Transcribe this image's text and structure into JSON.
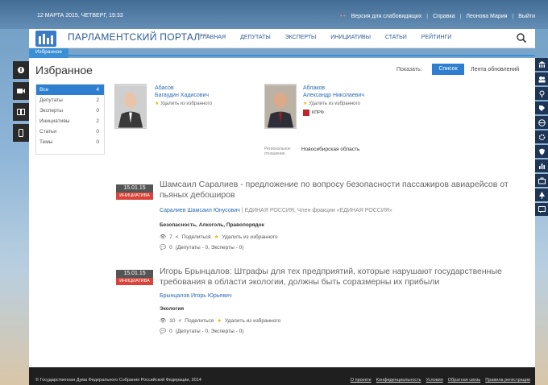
{
  "topbar": {
    "date": "12 МАРТА 2015, ЧЕТВЕРГ, 19:33",
    "accessible": "Версия для слабовидящих",
    "help": "Справка",
    "user": "Леонова Мария",
    "logout": "Выйти"
  },
  "header": {
    "title": "ПАРЛАМЕНТСКИЙ ПОРТАЛ",
    "beta": "beta",
    "nav": [
      "ГЛАВНАЯ",
      "ДЕПУТАТЫ",
      "ЭКСПЕРТЫ",
      "ИНИЦИАТИВЫ",
      "СТАТЬИ",
      "РЕЙТИНГИ"
    ]
  },
  "tabstrip": {
    "active": "Избранное"
  },
  "main": {
    "title": "Избранное",
    "show_label": "Показать:",
    "list_btn": "Список",
    "feed_btn": "Лента обновлений",
    "categories": [
      {
        "label": "Все",
        "count": "4"
      },
      {
        "label": "Депутаты",
        "count": "2"
      },
      {
        "label": "Эксперты",
        "count": "0"
      },
      {
        "label": "Инициативы",
        "count": "2"
      },
      {
        "label": "Статьи",
        "count": "0"
      },
      {
        "label": "Темы",
        "count": "0"
      }
    ],
    "deputies": [
      {
        "surname": "Абасов",
        "name": "Багаудин Хадисович",
        "remove": "Удалить из избранного"
      },
      {
        "surname": "Аблаков",
        "name": "Александр Николаевич",
        "remove": "Удалить из избранного",
        "party": "КПРФ",
        "region_label_1": "Региональное",
        "region_label_2": "отношение",
        "region": "Новосибирская область"
      }
    ],
    "items": [
      {
        "date": "15.01.15",
        "type": "ИНИЦИАТИВА",
        "title_1": "Шамсаил Саралиев - предложение по вопросу безопасности пассажиров авиарейсов от",
        "title_2": "пьяных дебоширов",
        "author": "Саралиев Шамсаил Юнусович",
        "party": "| ЕДИНАЯ РОССИЯ, Член фракции «ЕДИНАЯ РОССИЯ»",
        "tags": "Безопасность,  Алкоголь,  Правопорядок",
        "views": "7",
        "share": "Поделиться",
        "remove": "Удалить из избранного",
        "comments_count": "0",
        "comments_detail": "(Депутаты - 0, Эксперты - 0)"
      },
      {
        "date": "15.01.15",
        "type": "ИНИЦИАТИВА",
        "title_1": "Игорь Брынцалов: Штрафы для тех предприятий, которые нарушают государственные",
        "title_2": "требования в области экологии, должны быть соразмерны их прибыли",
        "author": "Брынцалов Игорь Юрьевич",
        "tags": "Экология",
        "views": "10",
        "share": "Поделиться",
        "remove": "Удалить из избранного",
        "comments_count": "0",
        "comments_detail": "(Депутаты - 0, Эксперты - 0)"
      }
    ]
  },
  "footer": {
    "copyright": "© Государственная Дума Федерального Собрания Российской Федерации, 2014",
    "links": [
      "О проекте",
      "Конфиденциальность",
      "Условия",
      "Обратная связь",
      "Правила регистрации"
    ]
  },
  "colors": {
    "accent": "#2e7fd0",
    "badge_red": "#d9443a",
    "dark": "#1f1f1f"
  }
}
